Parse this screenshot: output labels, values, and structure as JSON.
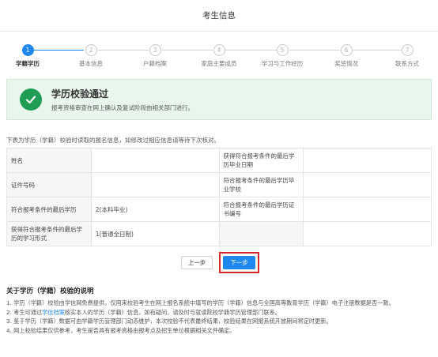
{
  "header": {
    "title": "考生信息"
  },
  "steps": [
    {
      "num": "1",
      "label": "学籍学历",
      "active": true
    },
    {
      "num": "2",
      "label": "基本信息",
      "active": false
    },
    {
      "num": "3",
      "label": "户籍档案",
      "active": false
    },
    {
      "num": "4",
      "label": "家庭主要成员",
      "active": false
    },
    {
      "num": "5",
      "label": "学习与工作经历",
      "active": false
    },
    {
      "num": "6",
      "label": "奖惩情况",
      "active": false
    },
    {
      "num": "7",
      "label": "联系方式",
      "active": false
    }
  ],
  "success": {
    "title": "学历校验通过",
    "desc": "报考资格审查在网上确认及复试阶段由相关部门进行。"
  },
  "note": "下表为学历（学籍）校验时读取的报名信息，如修改过相应信息请等待下次核对。",
  "table": {
    "rows": [
      {
        "label1": "姓名",
        "value1": "",
        "label2": "获得符合报考条件的最后学历毕业日期",
        "value2": ""
      },
      {
        "label1": "证件号码",
        "value1": "",
        "label2": "符合报考条件的最后学历毕业学校",
        "value2": ""
      },
      {
        "label1": "符合报考条件的最后学历",
        "value1": "2(本科毕业)",
        "label2": "符合报考条件的最后学历证书编号",
        "value2": ""
      },
      {
        "label1": "获得符合报考条件的最后学历的学习形式",
        "value1": "1(普通全日制)",
        "label2": "",
        "value2": ""
      }
    ]
  },
  "buttons": {
    "prev": "上一步",
    "next": "下一步"
  },
  "explanation": {
    "title": "关于学历（学籍）校验的说明",
    "items": [
      "1. 学历（学籍）校验由学信网免费提供，仅用来校验考生在网上报名系统中填写的学历（学籍）信息与全国高等教育学历（学籍）电子注册数据是否一致。",
      "3. 鉴于学历（学籍）数据可由学籍学历管理部门动态维护，本次校验不代表最终结果，校验结果在网报系统开放期间将定时更新。",
      "4. 网上校验结果仅供参考，考生是否具有报考资格由报考点及招生单位根据相关文件确定。"
    ],
    "item2": {
      "prefix": "2. 考生可通过",
      "link": "学信档案",
      "suffix": "核实本人的学历（学籍）信息，如有疑问，请及时与就读院校学籍学历管理部门联系。"
    }
  },
  "colors": {
    "accent": "#1e87f0",
    "success": "#1f9d55",
    "highlight": "#d6262e"
  }
}
